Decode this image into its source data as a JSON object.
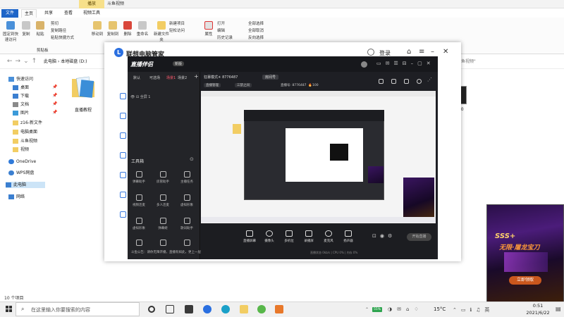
{
  "explorer": {
    "play_tab": "播放",
    "title": "斗鱼视频",
    "tabs": [
      "文件",
      "主页",
      "共享",
      "查看",
      "视频工具"
    ],
    "ribbon": {
      "pin": "固定到快速访问",
      "copy": "复制",
      "paste": "粘贴",
      "cut": "剪切",
      "copy_path": "复制路径",
      "paste_shortcut": "粘贴快捷方式",
      "move_to": "移动到",
      "copy_to": "复制到",
      "delete": "删除",
      "rename": "重命名",
      "new_folder": "新建文件夹",
      "new_item": "新建项目",
      "easy_access": "轻松访问",
      "properties": "属性",
      "open": "打开",
      "edit": "编辑",
      "history": "历史记录",
      "select_all": "全部选择",
      "select_none": "全部取消",
      "invert": "反向选择",
      "group_clipboard": "剪贴板"
    },
    "address": [
      "此电脑",
      "本地磁盘 (D:)"
    ],
    "search_placeholder": "斗鱼视频\"",
    "nav": [
      "快速访问",
      "桌面",
      "下载",
      "文档",
      "图片",
      "z16-新文件",
      "电脑桌面",
      "斗鱼视频",
      "视频",
      "OneDrive",
      "WPS网盘",
      "此电脑",
      "网络"
    ],
    "files": [
      {
        "name": "直播教程"
      },
      {
        "name": "2.0"
      }
    ],
    "status": "10 个项目"
  },
  "lenovo": {
    "logo": "L",
    "title": "联想电脑管家",
    "login": "登录"
  },
  "streaming_app": {
    "logo": "直播伴侣",
    "version": "新版",
    "scene_tabs": [
      "默认",
      "可选场",
      "场景1",
      "场景2"
    ],
    "sources": [
      "全屏 1"
    ],
    "room_info": "狂暴模式☀ 8776487",
    "uid": "房间号",
    "chips": [
      "直播管理",
      "三禁之间"
    ],
    "viewers_label": "直播号: 8776487",
    "fans": "100",
    "tools_title": "工具箱",
    "tools": [
      "弹幕助手",
      "房管助手",
      "主播任务",
      "视频连麦",
      "多人连麦",
      "虚拟形象",
      "虚拟形象",
      "弹幕姬",
      "歌词助手",
      "视频剪辑",
      "录屏",
      "更多"
    ],
    "notice": "斗鱼公告：请你无障开播，直播有如此，更上一层楼",
    "bottom_tools": [
      "直播屏幕",
      "摄像头",
      "多机位",
      "录播屏",
      "麦克风",
      "扬声器"
    ],
    "go_live": "开始直播",
    "status_text": "直播状态 0kb/s | CPU 0% | 内存 0%"
  },
  "game_ad": {
    "tag": "SSS+",
    "tagline": "无限·屠龙宝刀",
    "button": "立即领取"
  },
  "taskbar": {
    "search_placeholder": "在这里输入你要搜索的内容",
    "battery": "55%",
    "temperature": "15°C",
    "time": "0:51",
    "date": "2021/6/22"
  }
}
